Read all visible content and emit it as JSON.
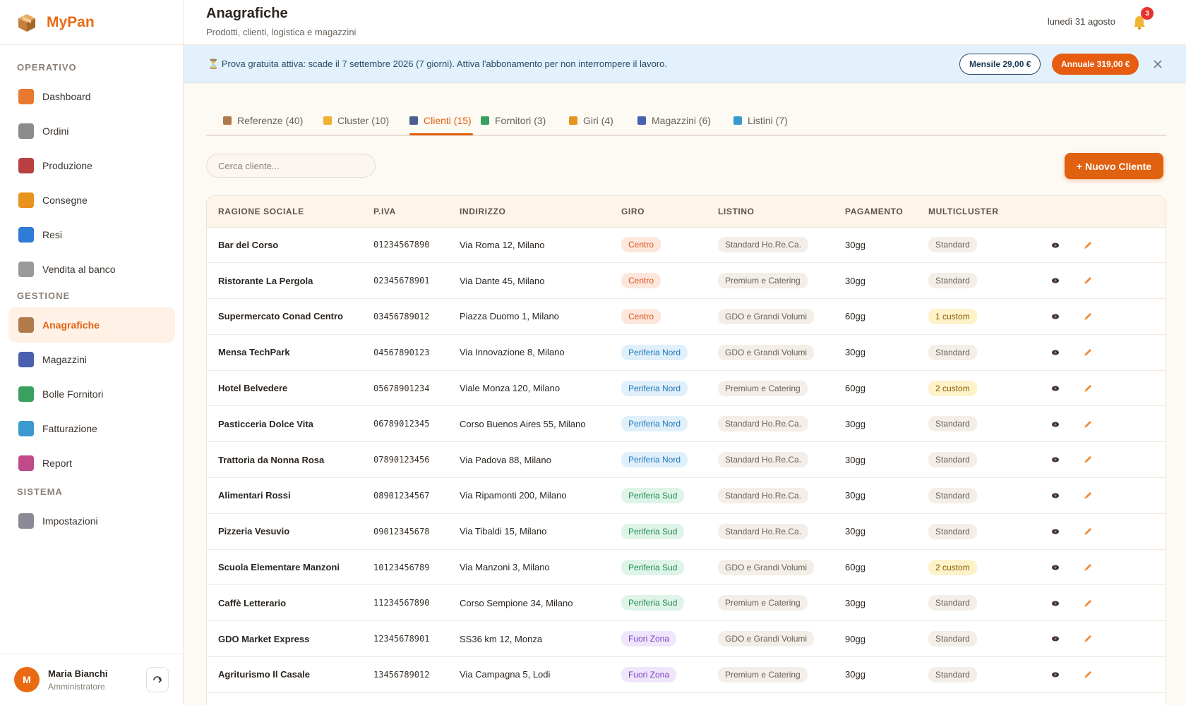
{
  "app": {
    "name": "MyPan",
    "brand_color": "#ea6a14"
  },
  "sidebar": {
    "sections": [
      {
        "label": "OPERATIVO",
        "items": [
          {
            "label": "Dashboard",
            "icon": "house-icon",
            "color": "#e8792e"
          },
          {
            "label": "Ordini",
            "icon": "cart-icon",
            "color": "#8c8c8c"
          },
          {
            "label": "Produzione",
            "icon": "factory-icon",
            "color": "#b84040"
          },
          {
            "label": "Consegne",
            "icon": "truck-icon",
            "color": "#e89220"
          },
          {
            "label": "Resi",
            "icon": "arrows-cycle-icon",
            "color": "#2f7bd6"
          },
          {
            "label": "Vendita al banco",
            "icon": "receipt-icon",
            "color": "#9a9a9a"
          }
        ]
      },
      {
        "label": "GESTIONE",
        "items": [
          {
            "label": "Anagrafiche",
            "icon": "package-icon",
            "color": "#b07a4a",
            "active": true
          },
          {
            "label": "Magazzini",
            "icon": "warehouse-icon",
            "color": "#4a5fb0"
          },
          {
            "label": "Bolle Fornitori",
            "icon": "delivery-truck-icon",
            "color": "#3aa060"
          },
          {
            "label": "Fatturazione",
            "icon": "money-icon",
            "color": "#3a9ad0"
          },
          {
            "label": "Report",
            "icon": "bar-chart-icon",
            "color": "#c04a8a"
          }
        ]
      },
      {
        "label": "SISTEMA",
        "items": [
          {
            "label": "Impostazioni",
            "icon": "gear-icon",
            "color": "#8a8a96"
          }
        ]
      }
    ],
    "user": {
      "initial": "M",
      "name": "Maria Bianchi",
      "role": "Amministratore"
    }
  },
  "header": {
    "title": "Anagrafiche",
    "subtitle": "Prodotti, clienti, logistica e magazzini",
    "date": "lunedì 31 agosto",
    "notifications": "3"
  },
  "trial": {
    "text": "Prova gratuita attiva: scade il 7 settembre 2026 (7 giorni). Attiva l'abbonamento per non interrompere il lavoro.",
    "monthly": "Mensile 29,00 €",
    "yearly": "Annuale 319,00 €"
  },
  "tabs": [
    {
      "label": "Referenze (40)",
      "icon": "package-icon",
      "color": "#b07a4a"
    },
    {
      "label": "Cluster (10)",
      "icon": "tag-icon",
      "color": "#f0b030"
    },
    {
      "label": "Clienti (15)",
      "icon": "people-icon",
      "color": "#4a5f90",
      "active": true
    },
    {
      "label": "Fornitori (3)",
      "icon": "delivery-truck-icon",
      "color": "#3aa060"
    },
    {
      "label": "Giri (4)",
      "icon": "truck-icon",
      "color": "#e89220"
    },
    {
      "label": "Magazzini (6)",
      "icon": "warehouse-icon",
      "color": "#4a5fb0"
    },
    {
      "label": "Listini (7)",
      "icon": "money-icon",
      "color": "#3a9ad0"
    }
  ],
  "toolbar": {
    "search_placeholder": "Cerca cliente...",
    "new_label": "+ Nuovo Cliente"
  },
  "table": {
    "columns": [
      "RAGIONE SOCIALE",
      "P.IVA",
      "INDIRIZZO",
      "GIRO",
      "LISTINO",
      "PAGAMENTO",
      "MULTICLUSTER",
      ""
    ],
    "giro_colors": {
      "Centro": {
        "bg": "#fde7dc",
        "fg": "#d9531e"
      },
      "Periferia Nord": {
        "bg": "#e0f0fb",
        "fg": "#1f78b8"
      },
      "Periferia Sud": {
        "bg": "#dff4e8",
        "fg": "#1f8a52"
      },
      "Fuori Zona": {
        "bg": "#efe6fb",
        "fg": "#7a3fc4"
      }
    },
    "rows": [
      {
        "name": "Bar del Corso",
        "piva": "01234567890",
        "address": "Via Roma 12, Milano",
        "giro": "Centro",
        "listino": "Standard Ho.Re.Ca.",
        "payment": "30gg",
        "multicluster": "Standard",
        "custom": false
      },
      {
        "name": "Ristorante La Pergola",
        "piva": "02345678901",
        "address": "Via Dante 45, Milano",
        "giro": "Centro",
        "listino": "Premium e Catering",
        "payment": "30gg",
        "multicluster": "Standard",
        "custom": false
      },
      {
        "name": "Supermercato Conad Centro",
        "piva": "03456789012",
        "address": "Piazza Duomo 1, Milano",
        "giro": "Centro",
        "listino": "GDO e Grandi Volumi",
        "payment": "60gg",
        "multicluster": "1 custom",
        "custom": true
      },
      {
        "name": "Mensa TechPark",
        "piva": "04567890123",
        "address": "Via Innovazione 8, Milano",
        "giro": "Periferia Nord",
        "listino": "GDO e Grandi Volumi",
        "payment": "30gg",
        "multicluster": "Standard",
        "custom": false
      },
      {
        "name": "Hotel Belvedere",
        "piva": "05678901234",
        "address": "Viale Monza 120, Milano",
        "giro": "Periferia Nord",
        "listino": "Premium e Catering",
        "payment": "60gg",
        "multicluster": "2 custom",
        "custom": true
      },
      {
        "name": "Pasticceria Dolce Vita",
        "piva": "06789012345",
        "address": "Corso Buenos Aires 55, Milano",
        "giro": "Periferia Nord",
        "listino": "Standard Ho.Re.Ca.",
        "payment": "30gg",
        "multicluster": "Standard",
        "custom": false
      },
      {
        "name": "Trattoria da Nonna Rosa",
        "piva": "07890123456",
        "address": "Via Padova 88, Milano",
        "giro": "Periferia Nord",
        "listino": "Standard Ho.Re.Ca.",
        "payment": "30gg",
        "multicluster": "Standard",
        "custom": false
      },
      {
        "name": "Alimentari Rossi",
        "piva": "08901234567",
        "address": "Via Ripamonti 200, Milano",
        "giro": "Periferia Sud",
        "listino": "Standard Ho.Re.Ca.",
        "payment": "30gg",
        "multicluster": "Standard",
        "custom": false
      },
      {
        "name": "Pizzeria Vesuvio",
        "piva": "09012345678",
        "address": "Via Tibaldi 15, Milano",
        "giro": "Periferia Sud",
        "listino": "Standard Ho.Re.Ca.",
        "payment": "30gg",
        "multicluster": "Standard",
        "custom": false
      },
      {
        "name": "Scuola Elementare Manzoni",
        "piva": "10123456789",
        "address": "Via Manzoni 3, Milano",
        "giro": "Periferia Sud",
        "listino": "GDO e Grandi Volumi",
        "payment": "60gg",
        "multicluster": "2 custom",
        "custom": true
      },
      {
        "name": "Caffè Letterario",
        "piva": "11234567890",
        "address": "Corso Sempione 34, Milano",
        "giro": "Periferia Sud",
        "listino": "Premium e Catering",
        "payment": "30gg",
        "multicluster": "Standard",
        "custom": false
      },
      {
        "name": "GDO Market Express",
        "piva": "12345678901",
        "address": "SS36 km 12, Monza",
        "giro": "Fuori Zona",
        "listino": "GDO e Grandi Volumi",
        "payment": "90gg",
        "multicluster": "Standard",
        "custom": false
      },
      {
        "name": "Agriturismo Il Casale",
        "piva": "13456789012",
        "address": "Via Campagna 5, Lodi",
        "giro": "Fuori Zona",
        "listino": "Premium e Catering",
        "payment": "30gg",
        "multicluster": "Standard",
        "custom": false
      }
    ]
  }
}
